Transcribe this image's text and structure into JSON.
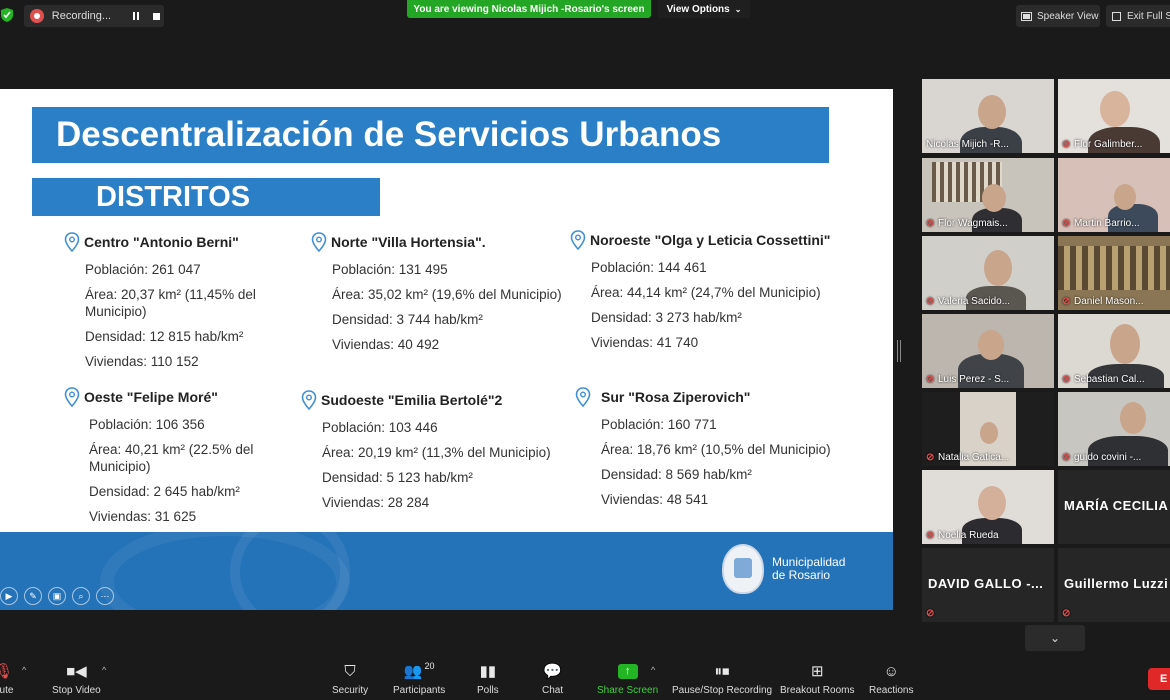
{
  "topbar": {
    "recording_label": "Recording...",
    "viewing_banner": "You are viewing Nicolas Mijich -Rosario's screen",
    "view_options_label": "View Options",
    "speaker_view_label": "Speaker View",
    "exit_full_label": "Exit Full S"
  },
  "slide": {
    "title": "Descentralización de Servicios Urbanos",
    "section": "DISTRITOS",
    "districts": [
      {
        "name": "Centro \"Antonio Berni\"",
        "poblacion": "Población: 261 047",
        "area": "Área: 20,37 km² (11,45% del Municipio)",
        "densidad": "Densidad: 12 815 hab/km²",
        "viviendas": "Viviendas: 110 152"
      },
      {
        "name": "Norte \"Villa Hortensia\".",
        "poblacion": "Población: 131 495",
        "area": "Área: 35,02 km² (19,6% del Municipio)",
        "densidad": "Densidad: 3 744 hab/km²",
        "viviendas": "Viviendas: 40 492"
      },
      {
        "name": "Noroeste \"Olga y Leticia Cossettini\"",
        "poblacion": "Población: 144 461",
        "area": "Área: 44,14 km² (24,7% del Municipio)",
        "densidad": "Densidad: 3 273 hab/km²",
        "viviendas": "Viviendas: 41 740"
      },
      {
        "name": "Oeste \"Felipe Moré\"",
        "poblacion": "Población: 106 356",
        "area": "Área: 40,21 km² (22.5% del Municipio)",
        "densidad": "Densidad: 2 645 hab/km²",
        "viviendas": "Viviendas: 31 625"
      },
      {
        "name": "Sudoeste \"Emilia Bertolé\"2",
        "poblacion": "Población: 103 446",
        "area": "Área: 20,19 km² (11,3% del Municipio)",
        "densidad": "Densidad: 5 123 hab/km²",
        "viviendas": "Viviendas: 28 284"
      },
      {
        "name": "Sur \"Rosa Ziperovich\"",
        "poblacion": "Población: 160 771",
        "area": "Área: 18,76 km² (10,5% del Municipio)",
        "densidad": "Densidad: 8 569 hab/km²",
        "viviendas": "Viviendas: 48 541"
      }
    ],
    "municipality_line1": "Municipalidad",
    "municipality_line2": "de Rosario"
  },
  "gallery": {
    "participants": [
      "Nicolas Mijich -R...",
      "Flor Galimber...",
      "Flor Wagmais...",
      "Martin Barrio...",
      "Valeria Sacido...",
      "Daniel Mason...",
      "Luis Perez - S...",
      "Sebastian Cal...",
      "Natalia Gatica...",
      "guido covini -...",
      "Noelia Rueda",
      "MARÍA CECILIA",
      "DAVID GALLO -...",
      "Guillermo Luzzi"
    ]
  },
  "toolbar": {
    "mute": "nute",
    "stop_video": "Stop Video",
    "security": "Security",
    "participants": "Participants",
    "participants_count": "20",
    "polls": "Polls",
    "chat": "Chat",
    "share_screen": "Share Screen",
    "pause_recording": "Pause/Stop Recording",
    "breakout_rooms": "Breakout Rooms",
    "reactions": "Reactions",
    "end": "E"
  },
  "colors": {
    "slide_blue": "#2a7fc6",
    "banner_green": "#23a623",
    "active_speaker": "#c8ee5a",
    "end_red": "#e02828"
  }
}
